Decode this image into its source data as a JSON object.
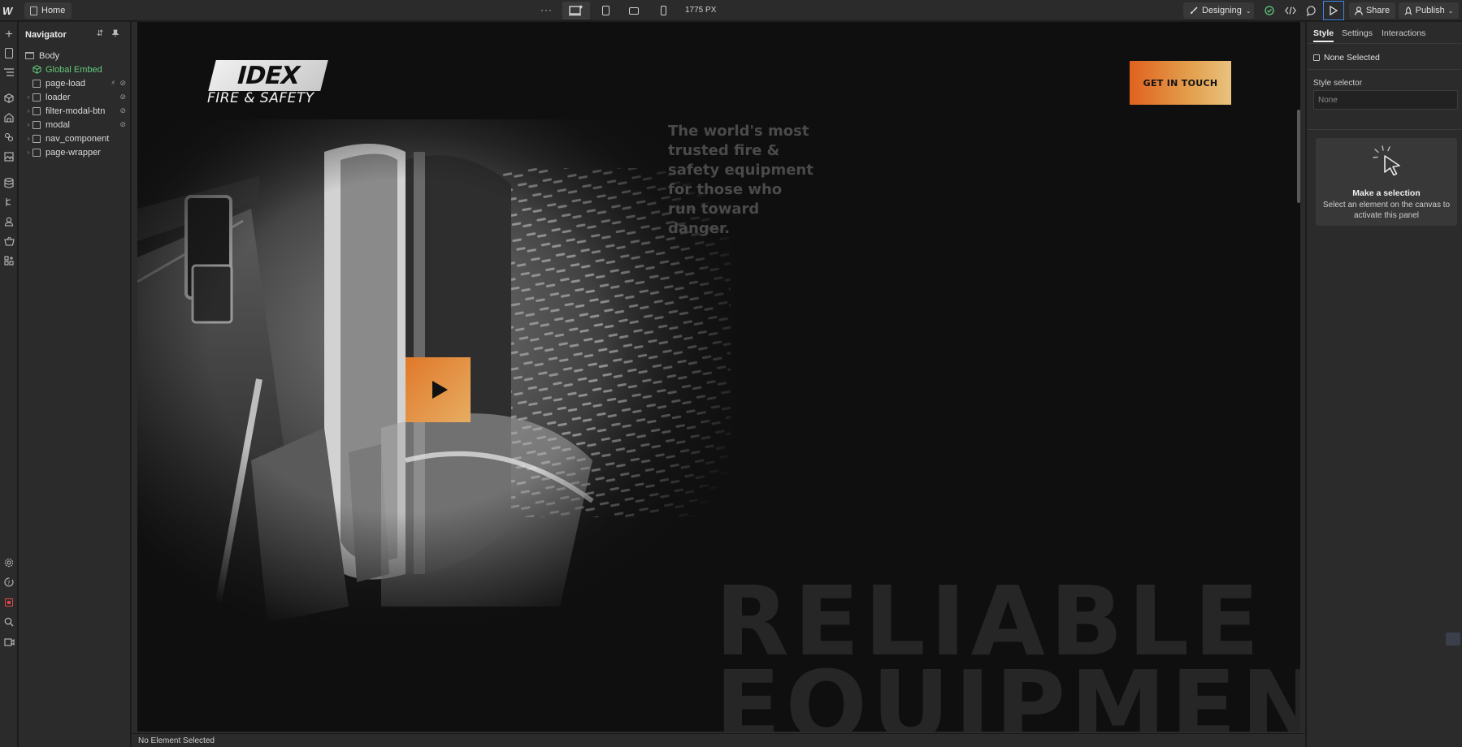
{
  "topbar": {
    "logo": "W",
    "page_name": "Home",
    "more": "···",
    "canvas_width": "1775 PX",
    "mode": "Designing",
    "share": "Share",
    "publish": "Publish"
  },
  "rail_icons": [
    "add-icon",
    "pages-icon",
    "navigator-icon",
    "components-icon",
    "variables-icon",
    "styles-icon",
    "assets-icon",
    "cms-icon",
    "logic-icon",
    "users-icon",
    "ecommerce-icon",
    "apps-icon",
    "settings-icon",
    "help-icon",
    "audit-icon",
    "search-icon",
    "video-icon"
  ],
  "navigator": {
    "title": "Navigator",
    "items": [
      {
        "label": "Body",
        "kind": "body"
      },
      {
        "label": "Global Embed",
        "kind": "component"
      },
      {
        "label": "page-load",
        "kind": "box"
      },
      {
        "label": "loader",
        "kind": "box"
      },
      {
        "label": "filter-modal-btn",
        "kind": "box"
      },
      {
        "label": "modal",
        "kind": "box"
      },
      {
        "label": "nav_component",
        "kind": "box"
      },
      {
        "label": "page-wrapper",
        "kind": "box"
      }
    ]
  },
  "canvas": {
    "brand_mark": "IDEX",
    "brand_sub": "FIRE & SAFETY",
    "cta": "GET IN TOUCH",
    "tagline": "The world's most trusted fire & safety equipment for those who run toward danger.",
    "headline_1": "RELIABLE",
    "headline_2": "EQUIPMENT."
  },
  "status": {
    "text": "No Element Selected"
  },
  "panel": {
    "tabs": [
      "Style",
      "Settings",
      "Interactions"
    ],
    "none_selected": "None Selected",
    "style_selector_label": "Style selector",
    "style_selector_placeholder": "None",
    "selection_title": "Make a selection",
    "selection_desc": "Select an element on the canvas to activate this panel"
  },
  "colors": {
    "accent_orange": "#e0621f",
    "accent_sand": "#e8c27e",
    "green": "#62c97a",
    "preview_border": "#3d86e6"
  }
}
